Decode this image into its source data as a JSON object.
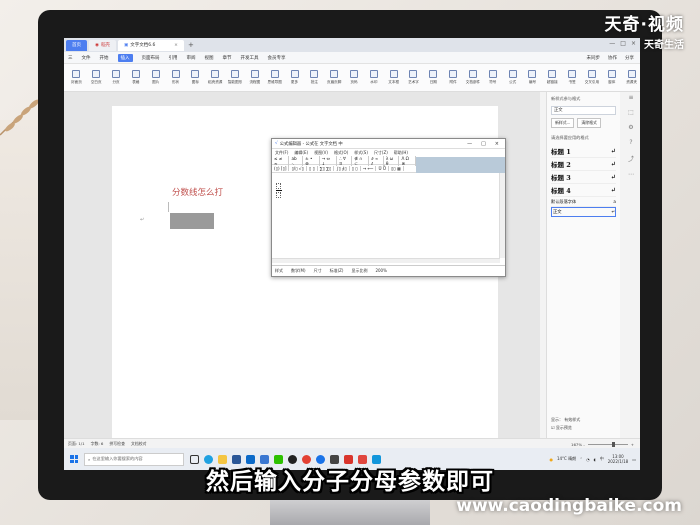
{
  "watermark": {
    "main": "天奇·视频",
    "sub": "天奇生活"
  },
  "subtitle": "然后输入分子分母参数即可",
  "site": "www.caodingbaike.com",
  "tabs": [
    {
      "label": "首页"
    },
    {
      "label": "稻壳"
    },
    {
      "label": "文字文档6.6"
    }
  ],
  "window_right": {
    "unsynced": "未同步",
    "share": "分享"
  },
  "menu": {
    "items": [
      "三",
      "文件",
      "开始",
      "插入",
      "页面布局",
      "引用",
      "审阅",
      "视图",
      "章节",
      "开发工具",
      "会员专享"
    ],
    "active_index": 3,
    "right": [
      "未同步",
      "协作",
      "分享"
    ]
  },
  "ribbon": [
    "封面页",
    "空白页",
    "分页",
    "表格",
    "图片",
    "形状",
    "图标",
    "稻壳资源",
    "智能图形",
    "流程图",
    "思维导图",
    "更多",
    "批注",
    "页眉页脚",
    "页码",
    "水印",
    "文本框",
    "艺术字",
    "日期",
    "附件",
    "文档部件",
    "符号",
    "公式",
    "编号",
    "超链接",
    "书签",
    "交叉引用",
    "窗体",
    "资源夹"
  ],
  "document": {
    "text": "分数线怎么打"
  },
  "right_panel": {
    "title": "新样式参与格式",
    "current_style": "正文",
    "new_style": "新样式...",
    "clear_format": "清除格式",
    "apply_label": "请选择要应用的格式",
    "styles": [
      "标题 1",
      "标题 2",
      "标题 3",
      "标题 4"
    ],
    "default_font": "默认段落字体",
    "selected": "正文",
    "show_label": "显示：",
    "show_value": "有效样式",
    "preview_label": "显示预览"
  },
  "statusbar": {
    "page": "页面: 1/1",
    "words": "字数: 6",
    "spell": "拼写检查",
    "proof": "文档校对",
    "zoom": "167% -"
  },
  "taskbar": {
    "search_placeholder": "在这里输入你要搜索的内容",
    "weather": "14°C 晴朗",
    "time": "13:00",
    "date": "2022/1/18",
    "lang": "中"
  },
  "dialog": {
    "title": "公式编辑器 - 公式在 文字文档 中",
    "menu": [
      "文件(F)",
      "编辑(E)",
      "视图(V)",
      "格式(O)",
      "样式(S)",
      "尺寸(Z)",
      "帮助(H)"
    ],
    "row1": [
      "≤ ≠ ≈",
      "ab ·.",
      "± • ⊗",
      "→ ⇔ ↓",
      "∴ ∀ ∃",
      "∉ ∩ ⊂",
      "∂ ∞ ℓ",
      "λ ω θ",
      "Λ Ω ⊗"
    ],
    "row2": [
      "(▯) [▯]",
      "▯/▯ √▯",
      "▯ ▯",
      "∑▯ ∑▯",
      "∫▯ ∮▯",
      "▯ ▯",
      "→ ⟵",
      "Ū Ů",
      "▯▯ ▦"
    ],
    "status": [
      "样式",
      "数学(M)",
      "尺寸",
      "标准(Z)",
      "显示比例",
      "200%"
    ]
  },
  "colors": {
    "accent": "#4d7ef0",
    "doc_text": "#c0504d",
    "toolbar_blank": "#b9cad9"
  }
}
